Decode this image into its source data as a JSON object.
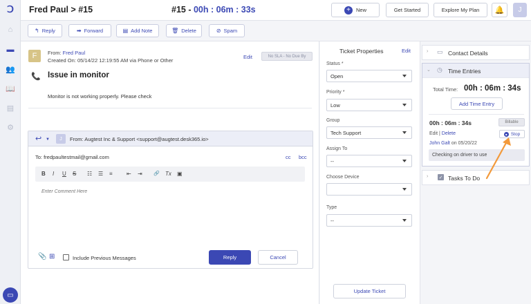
{
  "header": {
    "breadcrumb": "Fred Paul > #15",
    "ticket_ref": "#15 - ",
    "timer": "00h : 06m : 33s",
    "new_label": "New",
    "get_started_label": "Get Started",
    "explore_plan_label": "Explore My Plan",
    "avatar_initial": "J"
  },
  "actions": {
    "reply": "Reply",
    "forward": "Forward",
    "add_note": "Add Note",
    "delete": "Delete",
    "spam": "Spam"
  },
  "message": {
    "sender_initial": "F",
    "from_prefix": "From: ",
    "from_name": "Fred Paul",
    "created": "Created On: 05/14/22 12:19:55 AM via Phone or Other",
    "edit": "Edit",
    "sla": "No SLA - No Due By",
    "subject": "Issue in monitor",
    "body": "Monitor is not working properly. Please check"
  },
  "composer": {
    "avatar_initial": "J",
    "from": "From:  Augtest Inc & Support <support@augtest.desk365.io>",
    "to": "To: fredpaultestmail@gmail.com",
    "cc": "cc",
    "bcc": "bcc",
    "placeholder": "Enter Comment Here",
    "include_previous": "Include Previous Messages",
    "reply_btn": "Reply",
    "cancel_btn": "Cancel",
    "toolbar": {
      "bold": "B",
      "italic": "I",
      "underline": "U",
      "strike": "S",
      "ordered_list": "☷",
      "bullet_list": "☰",
      "align": "≡",
      "outdent": "⇤",
      "indent": "⇥",
      "link": "🔗",
      "clear_format": "Tx",
      "image": "▣"
    }
  },
  "properties": {
    "title": "Ticket Properties",
    "edit": "Edit",
    "status_label": "Status",
    "status_value": "Open",
    "priority_label": "Priority",
    "priority_value": "Low",
    "group_label": "Group",
    "group_value": "Tech Support",
    "assign_label": "Assign To",
    "assign_value": "--",
    "device_label": "Choose Device",
    "device_value": "",
    "type_label": "Type",
    "type_value": "--",
    "required_mark": "*",
    "update_btn": "Update Ticket"
  },
  "side": {
    "contact_details": "Contact Details",
    "time_entries": "Time Entries",
    "total_label": "Total Time:",
    "total_value": "00h : 06m : 34s",
    "add_time_entry": "Add Time Entry",
    "entry_time": "00h : 06m : 34s",
    "billable": "Billable",
    "edit": "Edit",
    "sep": " | ",
    "delete": "Delete",
    "stop": "Stop",
    "entry_user": "John Galt",
    "entry_date": " on 05/20/22",
    "entry_note": "Checking on driver to use",
    "tasks": "Tasks To Do"
  },
  "colors": {
    "accent": "#3b48b4",
    "annotation_arrow": "#f39a3b"
  },
  "icons": {
    "rail": [
      "desk365-logo-icon",
      "home-icon",
      "ticket-icon",
      "contacts-icon",
      "knowledge-base-icon",
      "reports-icon",
      "settings-icon"
    ],
    "chat": "chat-icon"
  }
}
